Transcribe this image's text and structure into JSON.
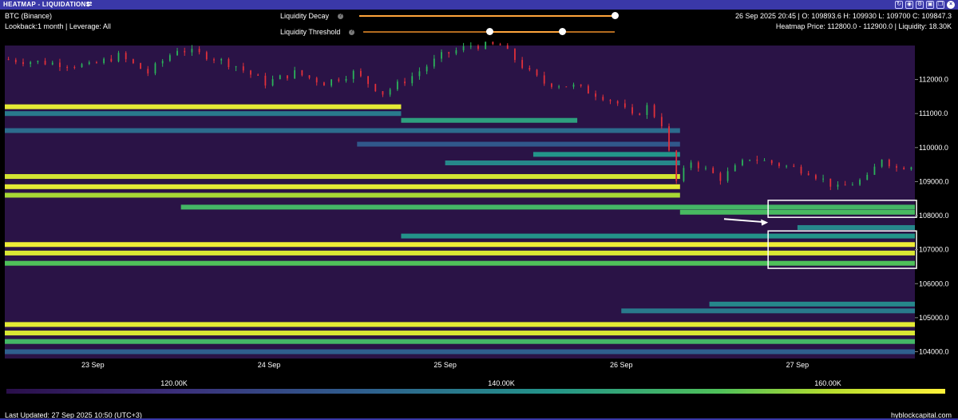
{
  "titlebar": {
    "title": "HEATMAP - LIQUIDATIONS",
    "swap_glyph": "⇄",
    "icons": [
      "refresh-icon",
      "camera-icon",
      "settings-icon",
      "save-icon",
      "copy-icon",
      "close-icon"
    ]
  },
  "header": {
    "symbol": "BTC (Binance)",
    "lookback": "Lookback:1 month | Leverage: All",
    "ohlc": "26 Sep 2025 20:45 | O: 109893.6 H: 109930 L: 109700 C: 109847.3",
    "heatmap_info": "Heatmap Price: 112800.0 - 112900.0 | Liquidity: 18.30K"
  },
  "controls": {
    "decay_label": "Liquidity Decay",
    "decay_value": 1.0,
    "threshold_label": "Liquidity Threshold",
    "threshold_range": [
      0.5,
      0.79
    ],
    "help_glyph": "?"
  },
  "colors": {
    "background": "#2a1346",
    "accent": "#ffa53c",
    "low": "#3b2f7a",
    "mid": "#23948a",
    "high": "#fff23a"
  },
  "chart_data": {
    "type": "heatmap",
    "title": "",
    "x_ticks": [
      "23 Sep",
      "24 Sep",
      "25 Sep",
      "26 Sep",
      "27 Sep"
    ],
    "y_ticks": [
      "112000.0",
      "111000.0",
      "110000.0",
      "109000.0",
      "108000.0",
      "107000.0",
      "106000.0",
      "105000.0",
      "104000.0"
    ],
    "ylim": [
      103800,
      113000
    ],
    "xlim": [
      "22 Sep 12:00",
      "27 Sep 16:00"
    ],
    "price_series": {
      "name": "BTC",
      "points": [
        [
          "22 Sep 12:00",
          112600
        ],
        [
          "22 Sep 18:00",
          112500
        ],
        [
          "23 Sep 00:00",
          112400
        ],
        [
          "23 Sep 04:00",
          112700
        ],
        [
          "23 Sep 08:00",
          112200
        ],
        [
          "23 Sep 12:00",
          112900
        ],
        [
          "23 Sep 16:00",
          112700
        ],
        [
          "23 Sep 20:00",
          112400
        ],
        [
          "24 Sep 00:00",
          111900
        ],
        [
          "24 Sep 04:00",
          112200
        ],
        [
          "24 Sep 08:00",
          111900
        ],
        [
          "24 Sep 12:00",
          112200
        ],
        [
          "24 Sep 16:00",
          111600
        ],
        [
          "24 Sep 20:00",
          112100
        ],
        [
          "25 Sep 00:00",
          112700
        ],
        [
          "25 Sep 04:00",
          113000
        ],
        [
          "25 Sep 08:00",
          113000
        ],
        [
          "25 Sep 12:00",
          112200
        ],
        [
          "25 Sep 14:00",
          111900
        ],
        [
          "25 Sep 18:00",
          111800
        ],
        [
          "25 Sep 22:00",
          111500
        ],
        [
          "26 Sep 00:00",
          111300
        ],
        [
          "26 Sep 02:00",
          110900
        ],
        [
          "26 Sep 04:00",
          111200
        ],
        [
          "26 Sep 06:00",
          110700
        ],
        [
          "26 Sep 08:00",
          109000
        ],
        [
          "26 Sep 10:00",
          109600
        ],
        [
          "26 Sep 14:00",
          109100
        ],
        [
          "26 Sep 18:00",
          109700
        ],
        [
          "26 Sep 22:00",
          109500
        ],
        [
          "27 Sep 02:00",
          109300
        ],
        [
          "27 Sep 06:00",
          108800
        ],
        [
          "27 Sep 10:00",
          109100
        ],
        [
          "27 Sep 12:00",
          109700
        ],
        [
          "27 Sep 14:00",
          109400
        ],
        [
          "27 Sep 16:00",
          109500
        ]
      ]
    },
    "liquidity_bands": [
      {
        "price": 111200,
        "from": "22 Sep 12:00",
        "to": "24 Sep 18:00",
        "level": 0.95
      },
      {
        "price": 111000,
        "from": "22 Sep 12:00",
        "to": "24 Sep 18:00",
        "level": 0.45
      },
      {
        "price": 110800,
        "from": "24 Sep 18:00",
        "to": "25 Sep 18:00",
        "level": 0.6
      },
      {
        "price": 110500,
        "from": "22 Sep 12:00",
        "to": "26 Sep 08:00",
        "level": 0.4
      },
      {
        "price": 110100,
        "from": "24 Sep 12:00",
        "to": "26 Sep 08:00",
        "level": 0.3
      },
      {
        "price": 109800,
        "from": "25 Sep 12:00",
        "to": "26 Sep 08:00",
        "level": 0.55
      },
      {
        "price": 109550,
        "from": "25 Sep 00:00",
        "to": "26 Sep 08:00",
        "level": 0.5
      },
      {
        "price": 109150,
        "from": "22 Sep 12:00",
        "to": "26 Sep 08:00",
        "level": 0.92
      },
      {
        "price": 108850,
        "from": "22 Sep 12:00",
        "to": "26 Sep 08:00",
        "level": 0.95
      },
      {
        "price": 108600,
        "from": "22 Sep 12:00",
        "to": "26 Sep 08:00",
        "level": 0.85
      },
      {
        "price": 108250,
        "from": "23 Sep 12:00",
        "to": "27 Sep 16:00",
        "level": 0.7
      },
      {
        "price": 108100,
        "from": "26 Sep 08:00",
        "to": "27 Sep 16:00",
        "level": 0.72
      },
      {
        "price": 107650,
        "from": "27 Sep 00:00",
        "to": "27 Sep 16:00",
        "level": 0.5
      },
      {
        "price": 107400,
        "from": "24 Sep 18:00",
        "to": "27 Sep 16:00",
        "level": 0.55
      },
      {
        "price": 107150,
        "from": "22 Sep 12:00",
        "to": "27 Sep 16:00",
        "level": 0.97
      },
      {
        "price": 106900,
        "from": "22 Sep 12:00",
        "to": "27 Sep 16:00",
        "level": 0.93
      },
      {
        "price": 106600,
        "from": "22 Sep 12:00",
        "to": "27 Sep 16:00",
        "level": 0.75
      },
      {
        "price": 105400,
        "from": "26 Sep 12:00",
        "to": "27 Sep 16:00",
        "level": 0.5
      },
      {
        "price": 105200,
        "from": "26 Sep 00:00",
        "to": "27 Sep 16:00",
        "level": 0.45
      },
      {
        "price": 104800,
        "from": "22 Sep 12:00",
        "to": "27 Sep 16:00",
        "level": 0.95
      },
      {
        "price": 104550,
        "from": "22 Sep 12:00",
        "to": "27 Sep 16:00",
        "level": 0.93
      },
      {
        "price": 104300,
        "from": "22 Sep 12:00",
        "to": "27 Sep 16:00",
        "level": 0.7
      },
      {
        "price": 104000,
        "from": "22 Sep 12:00",
        "to": "27 Sep 16:00",
        "level": 0.35
      }
    ],
    "colorbar": {
      "ticks": [
        "120.00K",
        "140.00K",
        "160.00K"
      ]
    },
    "annotations": [
      {
        "type": "arrow",
        "from": [
          "26 Sep 14:00",
          107900
        ],
        "to": [
          "26 Sep 20:00",
          107800
        ]
      },
      {
        "type": "box",
        "x0": "26 Sep 20:00",
        "x1": "27 Sep 16:00",
        "y0": 107950,
        "y1": 108450
      },
      {
        "type": "box",
        "x0": "26 Sep 20:00",
        "x1": "27 Sep 16:00",
        "y0": 106450,
        "y1": 107550
      }
    ]
  },
  "footer": {
    "updated": "Last Updated: 27 Sep 2025 10:50 (UTC+3)",
    "site": "hyblockcapital.com"
  }
}
